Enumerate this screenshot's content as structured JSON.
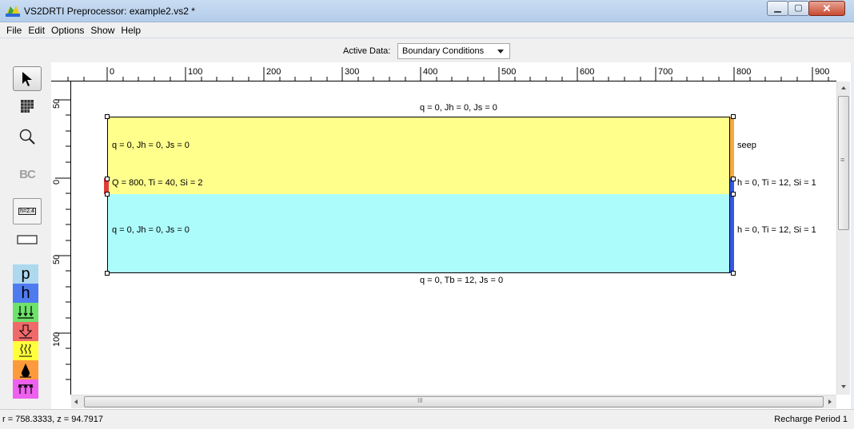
{
  "window": {
    "title": "VS2DRTI Preprocessor: example2.vs2 *",
    "minimize_icon": "minimize-icon",
    "maximize_icon": "maximize-icon",
    "close_icon": "close-icon"
  },
  "menu": [
    "File",
    "Edit",
    "Options",
    "Show",
    "Help"
  ],
  "active_data": {
    "label": "Active Data:",
    "selected": "Boundary Conditions"
  },
  "tools": {
    "select": "arrow-pointer-icon",
    "mesh": "mesh-grid-icon",
    "zoom": "magnifier-icon",
    "bc": "BC",
    "hvalue": "h=2.4",
    "rect": "rectangle-icon",
    "bc_p": "p",
    "bc_h": "h",
    "colors": {
      "p": "#add8ee",
      "h": "#4f7bf0",
      "flux": "#6ee26a",
      "seep_arrow": "#f06a6a",
      "evap": "#ffff3c",
      "drop": "#ff9a3c",
      "pond": "#ee60ee"
    }
  },
  "rulers": {
    "horizontal": [
      "0",
      "100",
      "200",
      "300",
      "400",
      "500",
      "600",
      "700",
      "800",
      "900"
    ],
    "vertical": [
      "50",
      "0",
      "50",
      "100"
    ]
  },
  "boundary_labels": {
    "top": "q = 0, Jh = 0, Js = 0",
    "left_upper": "q = 0, Jh = 0, Js = 0",
    "source": "Q = 800, Ti = 40, Si = 2",
    "left_lower": "q = 0, Jh = 0, Js = 0",
    "right_seep": "seep",
    "right_mid": "h = 0, Ti = 12, Si = 1",
    "right_lower": "h = 0, Ti = 12, Si = 1",
    "bottom": "q = 0, Tb = 12, Js = 0"
  },
  "zone_colors": {
    "upper": "#ffff8c",
    "lower": "#adfcfc",
    "seep": "#f8a93e",
    "head": "#3457e8",
    "source": "#e03c3c"
  },
  "scrollbar": {
    "h_grip": "III",
    "v_grip": "≡"
  },
  "status": {
    "coords": "r = 758.3333, z = 94.7917",
    "period": "Recharge Period 1"
  }
}
